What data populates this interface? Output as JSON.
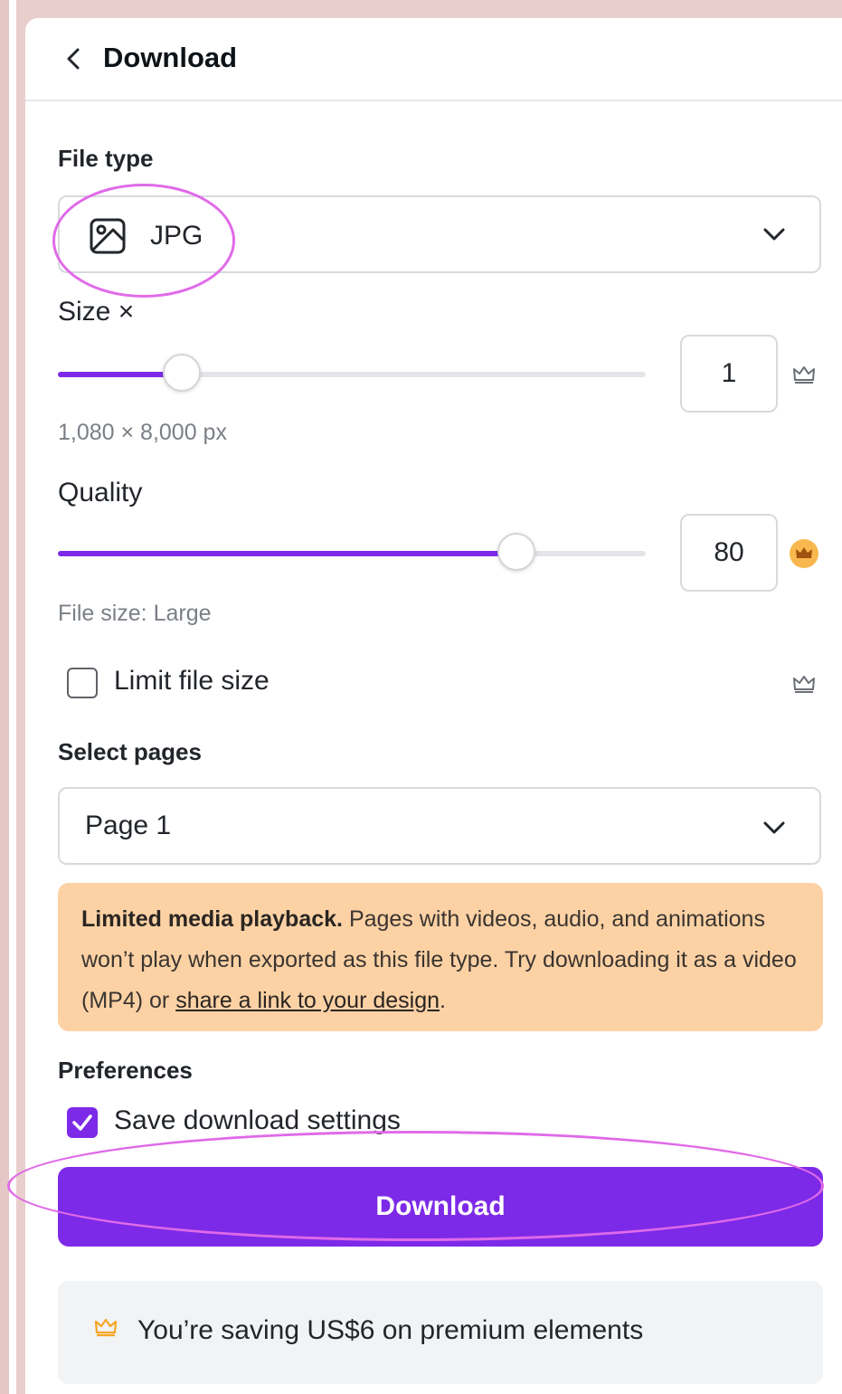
{
  "header": {
    "title": "Download",
    "back_icon": "chevron-left-icon"
  },
  "file_type": {
    "label": "File type",
    "value": "JPG",
    "icon": "image-icon"
  },
  "size": {
    "label": "Size ×",
    "value": "1",
    "slider_percent": 21,
    "dimensions": "1,080 × 8,000 px"
  },
  "quality": {
    "label": "Quality",
    "value": "80",
    "slider_percent": 78,
    "file_size": "File size: Large"
  },
  "limit_file_size": {
    "label": "Limit file size",
    "checked": false
  },
  "select_pages": {
    "label": "Select pages",
    "value": "Page 1"
  },
  "notice": {
    "bold": "Limited media playback.",
    "text": " Pages with videos, audio, and animations won’t play when exported as this file type. Try downloading it as a video (MP4) or ",
    "link": "share a link to your design",
    "end": "."
  },
  "preferences": {
    "label": "Preferences",
    "save_settings_label": "Save download settings",
    "save_settings_checked": true
  },
  "download_button": "Download",
  "saving_message": "You’re saving US$6 on premium elements",
  "colors": {
    "accent": "#7d2ae8",
    "notice_bg": "#fcd2a5",
    "crown_gold": "#f5a623",
    "annotation": "#e06ae8"
  }
}
